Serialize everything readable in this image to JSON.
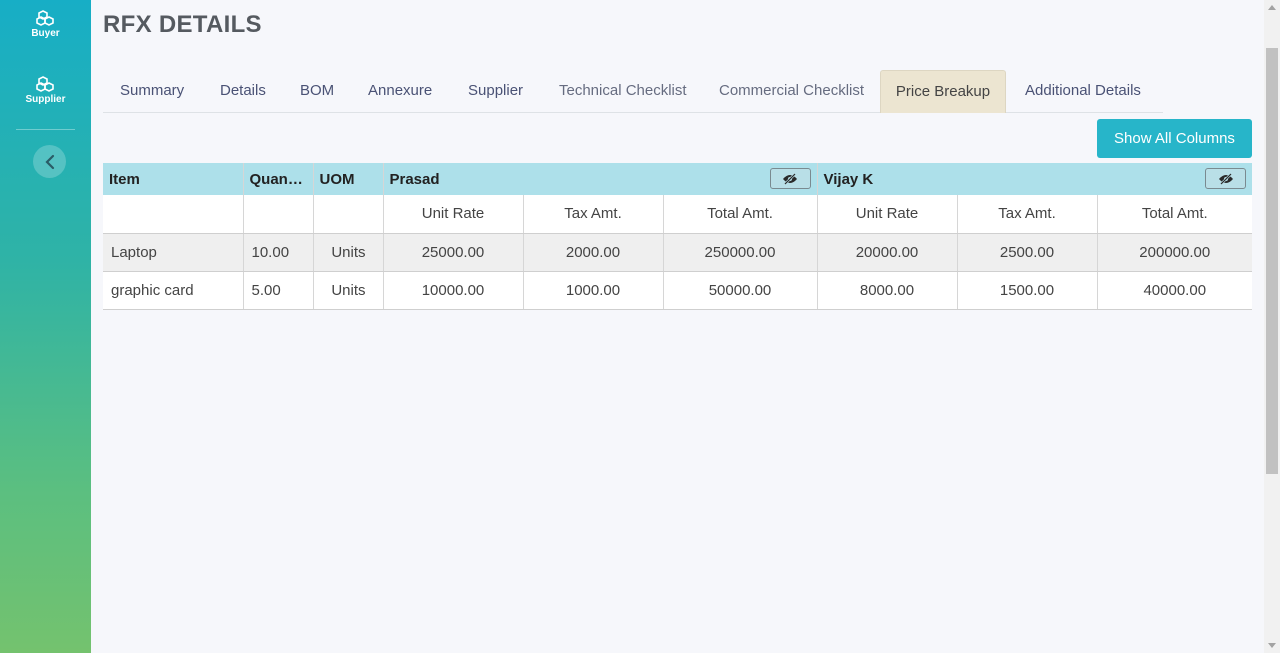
{
  "sidebar": {
    "items": [
      {
        "label": "Buyer",
        "icon": "boxes-icon"
      },
      {
        "label": "Supplier",
        "icon": "boxes-icon"
      }
    ],
    "collapse_icon": "chevron-left-icon"
  },
  "page": {
    "title": "RFX DETAILS"
  },
  "tabs": [
    {
      "label": "Summary"
    },
    {
      "label": "Details"
    },
    {
      "label": "BOM"
    },
    {
      "label": "Annexure"
    },
    {
      "label": "Supplier"
    },
    {
      "label": "Technical Checklist"
    },
    {
      "label": "Commercial Checklist"
    },
    {
      "label": "Price Breakup",
      "active": true
    },
    {
      "label": "Additional Details"
    }
  ],
  "toolbar": {
    "show_all_label": "Show All Columns"
  },
  "table": {
    "headers": {
      "item": "Item",
      "quantity": "Quantity",
      "uom": "UOM"
    },
    "suppliers": [
      {
        "name": "Prasad",
        "icon": "eye-slash-icon"
      },
      {
        "name": "Vijay K",
        "icon": "eye-slash-icon"
      }
    ],
    "subheaders": [
      "Unit Rate",
      "Tax Amt.",
      "Total Amt.",
      "Unit Rate",
      "Tax Amt.",
      "Total Amt."
    ],
    "rows": [
      {
        "item": "Laptop",
        "quantity": "10.00",
        "uom": "Units",
        "values": [
          "25000.00",
          "2000.00",
          "250000.00",
          "20000.00",
          "2500.00",
          "200000.00"
        ]
      },
      {
        "item": "graphic card",
        "quantity": "5.00",
        "uom": "Units",
        "values": [
          "10000.00",
          "1000.00",
          "50000.00",
          "8000.00",
          "1500.00",
          "40000.00"
        ]
      }
    ]
  },
  "colors": {
    "sidebar_top": "#17aec6",
    "sidebar_bottom": "#74c26e",
    "accent": "#27b5c9",
    "header_bg": "#ade0ea",
    "active_tab": "#ece5d1"
  }
}
